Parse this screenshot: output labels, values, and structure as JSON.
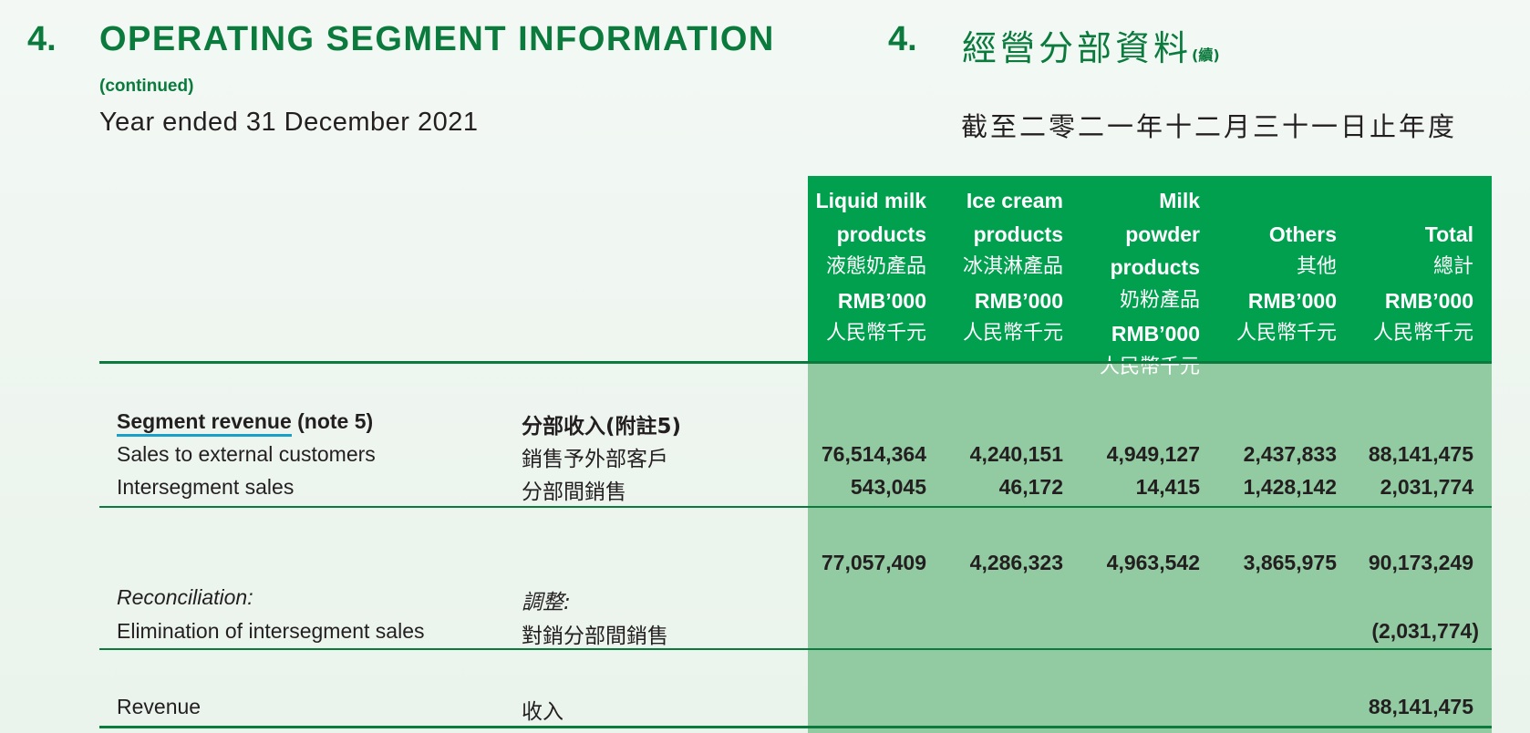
{
  "header": {
    "section_number": "4.",
    "title_en": "OPERATING SEGMENT INFORMATION",
    "section_number_cn": "4.",
    "title_cn": "經營分部資料",
    "title_cn_suffix": "(續)",
    "continued": "(continued)",
    "period_en": "Year ended 31 December 2021",
    "period_cn": "截至二零二一年十二月三十一日止年度"
  },
  "columns": [
    {
      "name_en_1": "Liquid milk",
      "name_en_2": "products",
      "name_cn": "液態奶產品",
      "unit_en": "RMB’000",
      "unit_cn": "人民幣千元"
    },
    {
      "name_en_1": "Ice cream",
      "name_en_2": "products",
      "name_cn": "冰淇淋產品",
      "unit_en": "RMB’000",
      "unit_cn": "人民幣千元"
    },
    {
      "name_en_1": "Milk powder",
      "name_en_2": "products",
      "name_cn": "奶粉產品",
      "unit_en": "RMB’000",
      "unit_cn": "人民幣千元"
    },
    {
      "name_en_1": "",
      "name_en_2": "Others",
      "name_cn": "其他",
      "unit_en": "RMB’000",
      "unit_cn": "人民幣千元"
    },
    {
      "name_en_1": "",
      "name_en_2": "Total",
      "name_cn": "總計",
      "unit_en": "RMB’000",
      "unit_cn": "人民幣千元"
    }
  ],
  "rows": {
    "segment_revenue": {
      "label_en_main": "Segment revenue",
      "label_en_note": " (note 5)",
      "label_cn": "分部收入(附註5)"
    },
    "external": {
      "label_en": "Sales to external customers",
      "label_cn": "銷售予外部客戶",
      "values": [
        "76,514,364",
        "4,240,151",
        "4,949,127",
        "2,437,833",
        "88,141,475"
      ]
    },
    "intersegment": {
      "label_en": "Intersegment sales",
      "label_cn": "分部間銷售",
      "values": [
        "543,045",
        "46,172",
        "14,415",
        "1,428,142",
        "2,031,774"
      ]
    },
    "subtotal": {
      "values": [
        "77,057,409",
        "4,286,323",
        "4,963,542",
        "3,865,975",
        "90,173,249"
      ]
    },
    "reconciliation": {
      "label_en": "Reconciliation:",
      "label_cn": "調整:"
    },
    "elimination": {
      "label_en": "Elimination of intersegment sales",
      "label_cn": "對銷分部間銷售",
      "total": "(2,031,774)"
    },
    "revenue": {
      "label_en": "Revenue",
      "label_cn": "收入",
      "total": "88,141,475"
    }
  }
}
